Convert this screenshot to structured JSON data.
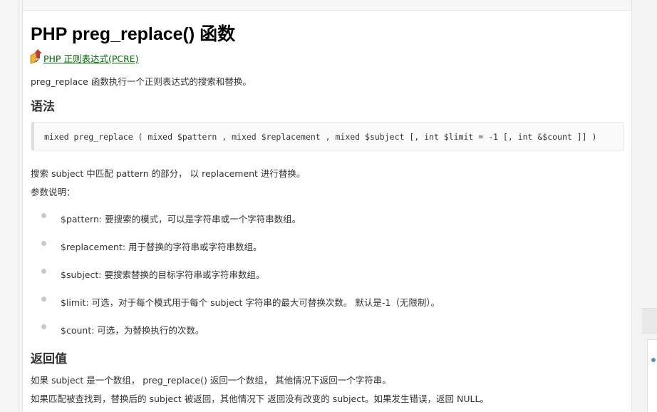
{
  "title": "PHP preg_replace() 函数",
  "category_link": "PHP 正则表达式(PCRE)",
  "intro": "preg_replace 函数执行一个正则表达式的搜索和替换。",
  "syntax_heading": "语法",
  "syntax_code": "mixed preg_replace ( mixed $pattern , mixed $replacement , mixed $subject [, int $limit = -1 [, int &$count ]] )",
  "desc": "搜索 subject 中匹配 pattern 的部分， 以 replacement 进行替换。",
  "params_heading": "参数说明：",
  "params": [
    "$pattern: 要搜索的模式，可以是字符串或一个字符串数组。",
    "$replacement: 用于替换的字符串或字符串数组。",
    "$subject: 要搜索替换的目标字符串或字符串数组。",
    "$limit: 可选，对于每个模式用于每个 subject 字符串的最大可替换次数。 默认是-1（无限制）。",
    "$count: 可选，为替换执行的次数。"
  ],
  "return_heading": "返回值",
  "return_lines": [
    "如果 subject 是一个数组， preg_replace() 返回一个数组， 其他情况下返回一个字符串。",
    "如果匹配被查找到，替换后的 subject 被返回，其他情况下 返回没有改变的 subject。如果发生错误，返回 NULL。"
  ],
  "icon": "up-arrow-icon",
  "colors": {
    "link": "#006600",
    "text": "#333333",
    "title": "#000000",
    "bullet": "#c9c9c9",
    "code_bg": "#fbfbfb"
  }
}
